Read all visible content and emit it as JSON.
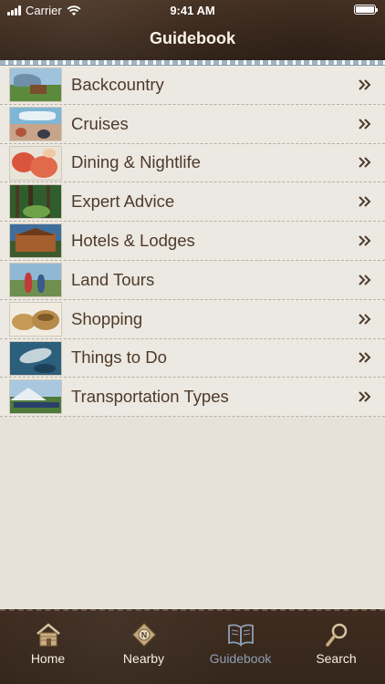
{
  "status": {
    "carrier": "Carrier",
    "time": "9:41 AM"
  },
  "header": {
    "title": "Guidebook"
  },
  "list": {
    "items": [
      {
        "label": "Backcountry",
        "icon": "backcountry-thumbnail"
      },
      {
        "label": "Cruises",
        "icon": "cruises-thumbnail"
      },
      {
        "label": "Dining & Nightlife",
        "icon": "dining-thumbnail"
      },
      {
        "label": "Expert Advice",
        "icon": "expert-advice-thumbnail"
      },
      {
        "label": "Hotels & Lodges",
        "icon": "hotels-thumbnail"
      },
      {
        "label": "Land Tours",
        "icon": "land-tours-thumbnail"
      },
      {
        "label": "Shopping",
        "icon": "shopping-thumbnail"
      },
      {
        "label": "Things to Do",
        "icon": "things-to-do-thumbnail"
      },
      {
        "label": "Transportation Types",
        "icon": "transportation-thumbnail"
      }
    ]
  },
  "tabs": [
    {
      "label": "Home",
      "icon": "cabin-icon",
      "active": false
    },
    {
      "label": "Nearby",
      "icon": "compass-icon",
      "active": false
    },
    {
      "label": "Guidebook",
      "icon": "open-book-icon",
      "active": true
    },
    {
      "label": "Search",
      "icon": "magnifier-icon",
      "active": false
    }
  ],
  "colors": {
    "header_bg": "#3c2a1e",
    "title_text": "#fbf4e6",
    "row_text": "#4e3a2a",
    "active_tab": "#8d9fb4"
  }
}
